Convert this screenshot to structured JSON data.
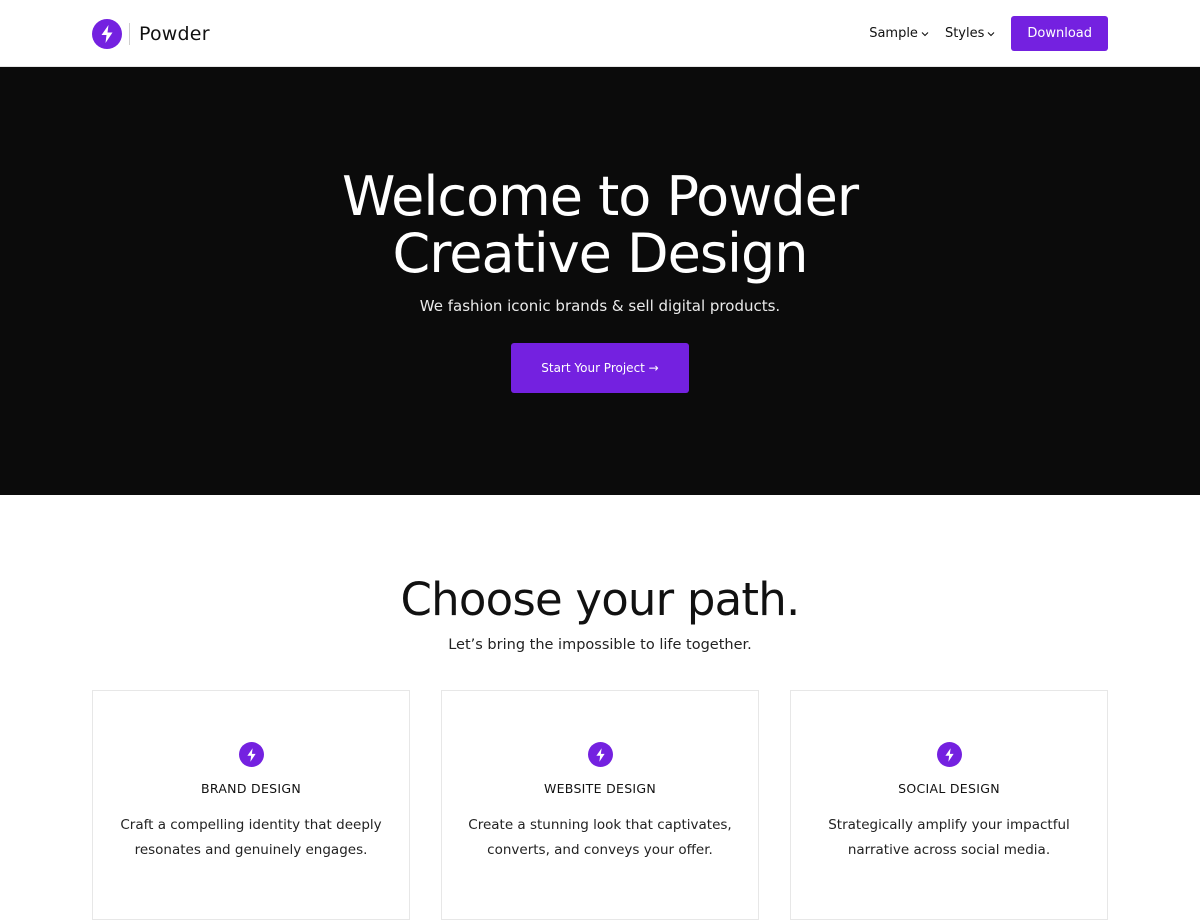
{
  "brand": {
    "name": "Powder",
    "accent": "#7421e0"
  },
  "nav": {
    "items": [
      {
        "label": "Sample"
      },
      {
        "label": "Styles"
      }
    ],
    "download_label": "Download"
  },
  "hero": {
    "title_line1": "Welcome to Powder",
    "title_line2": "Creative Design",
    "subtitle": "We fashion iconic brands & sell digital products.",
    "cta_label": "Start Your Project →",
    "background": "#0b0b0b"
  },
  "paths": {
    "title": "Choose your path.",
    "subtitle": "Let’s bring the impossible to life together.",
    "cards": [
      {
        "icon": "lightning-icon",
        "title": "BRAND DESIGN",
        "line1": "Craft a compelling identity that deeply",
        "line2": "resonates and genuinely engages."
      },
      {
        "icon": "lightning-icon",
        "title": "WEBSITE DESIGN",
        "line1": "Create a stunning look that captivates,",
        "line2": "converts, and conveys your offer."
      },
      {
        "icon": "lightning-icon",
        "title": "SOCIAL DESIGN",
        "line1": "Strategically amplify your impactful",
        "line2": "narrative across social media."
      }
    ]
  }
}
